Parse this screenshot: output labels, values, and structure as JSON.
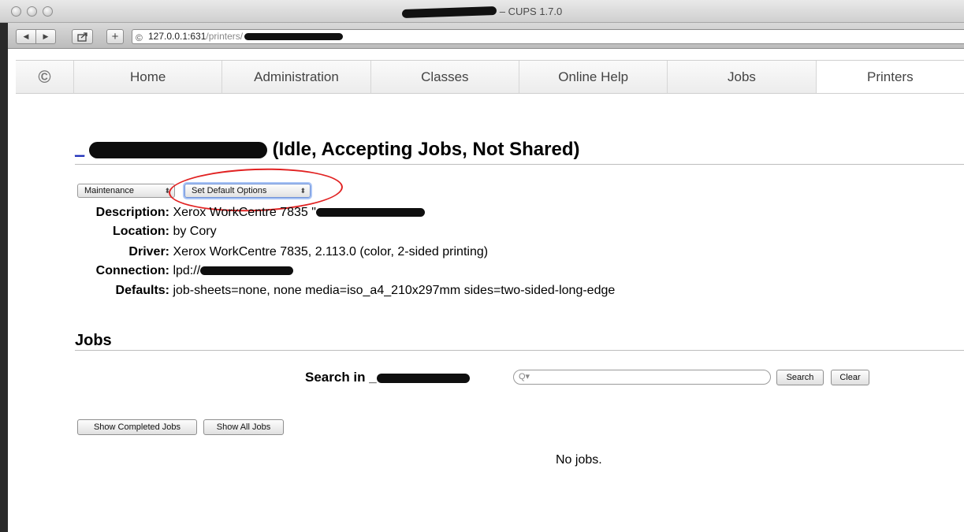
{
  "window": {
    "title": "– CUPS 1.7.0",
    "url_host": "127.0.0.1:631",
    "url_path": "/printers/"
  },
  "nav": {
    "items": [
      "Home",
      "Administration",
      "Classes",
      "Online Help",
      "Jobs",
      "Printers"
    ],
    "active": "Printers"
  },
  "printer": {
    "heading_link_prefix": "_",
    "status": "(Idle, Accepting Jobs, Not Shared)",
    "maintenance_select": "Maintenance",
    "admin_select": "Set Default Options",
    "details": [
      {
        "key": "Description:",
        "value": "Xerox WorkCentre 7835 \""
      },
      {
        "key": "Location:",
        "value": "by Cory"
      },
      {
        "key": "Driver:",
        "value": "Xerox WorkCentre 7835, 2.113.0 (color, 2-sided printing)"
      },
      {
        "key": "Connection:",
        "value": "lpd://"
      },
      {
        "key": "Defaults:",
        "value": "job-sheets=none, none media=iso_a4_210x297mm sides=two-sided-long-edge"
      }
    ]
  },
  "jobs": {
    "heading": "Jobs",
    "search_label": "Search in _",
    "search_placeholder": "Q▾",
    "search_button": "Search",
    "clear_button": "Clear",
    "show_completed": "Show Completed Jobs",
    "show_all": "Show All Jobs",
    "empty": "No jobs."
  }
}
